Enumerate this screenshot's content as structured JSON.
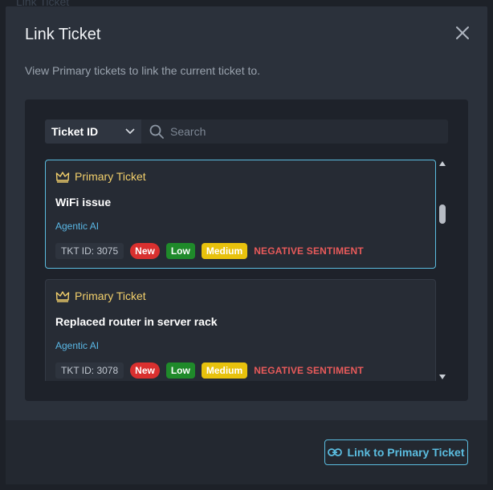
{
  "background": {
    "top_text": "Link Ticket"
  },
  "modal": {
    "title": "Link Ticket",
    "description": "View Primary tickets to link the current ticket to.",
    "close_icon": "close-icon"
  },
  "filter": {
    "select_label": "Ticket ID",
    "search_placeholder": "Search"
  },
  "tickets": [
    {
      "header": "Primary Ticket",
      "title": "WiFi issue",
      "team": "Agentic AI",
      "ticket_id": "TKT ID: 3075",
      "status": "New",
      "priority": "Low",
      "impact": "Medium",
      "sentiment": "NEGATIVE SENTIMENT",
      "selected": true
    },
    {
      "header": "Primary Ticket",
      "title": "Replaced router in server rack",
      "team": "Agentic AI",
      "ticket_id": "TKT ID: 3078",
      "status": "New",
      "priority": "Low",
      "impact": "Medium",
      "sentiment": "NEGATIVE SENTIMENT",
      "selected": false
    }
  ],
  "footer": {
    "link_button": "Link to Primary Ticket"
  },
  "colors": {
    "accent": "#5bbde0",
    "primary_gold": "#f2cf6b",
    "status_new": "#d9302f",
    "priority_low": "#1f8a2a",
    "impact_medium": "#e8c20d",
    "sentiment_negative": "#e85a5a"
  }
}
